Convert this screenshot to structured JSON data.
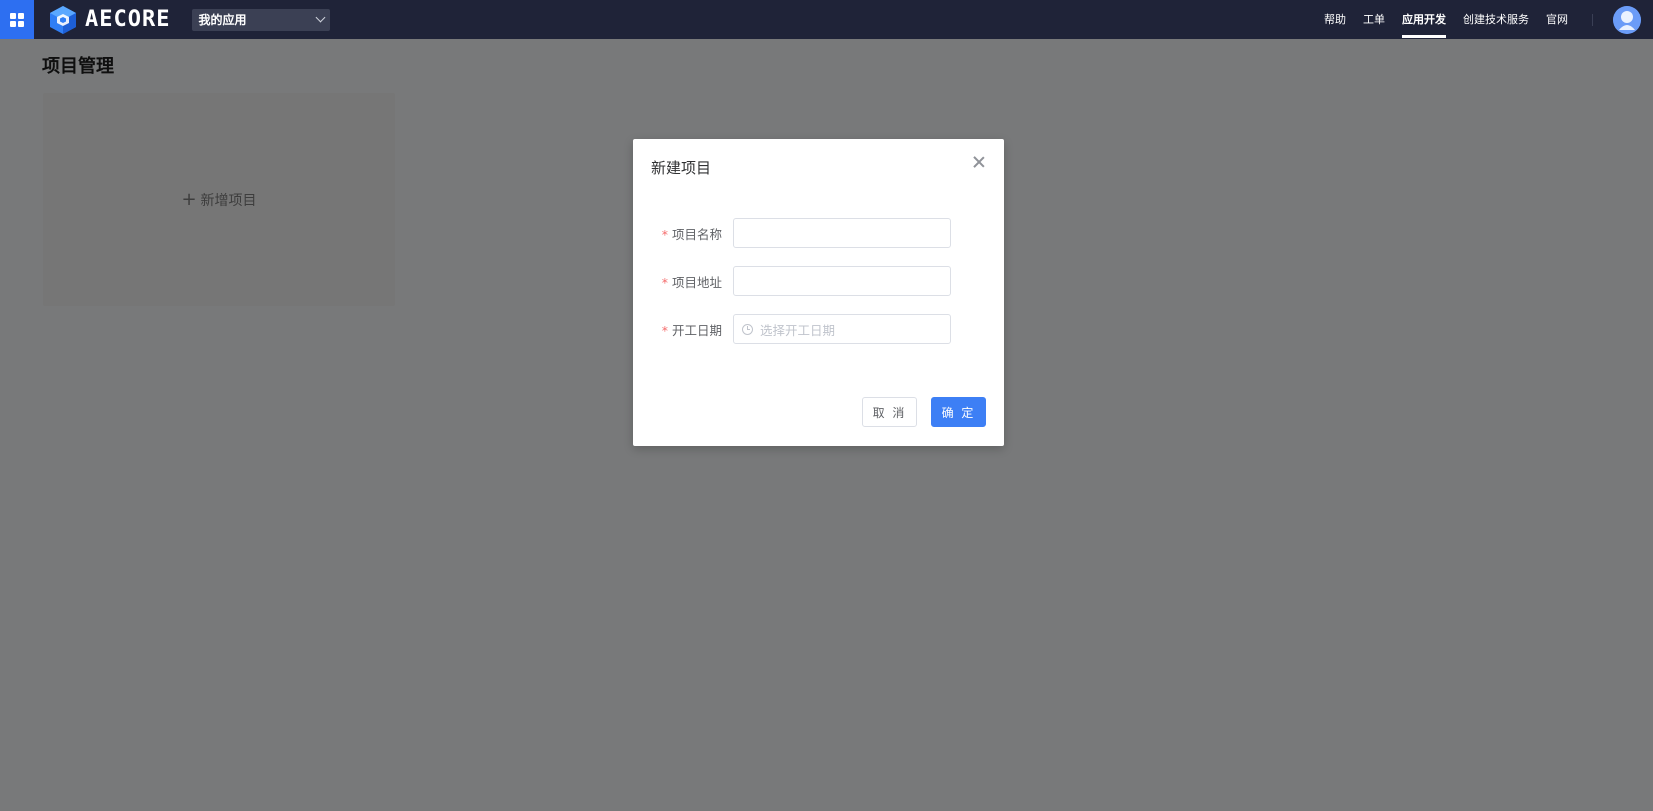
{
  "topbar": {
    "logo_text": "AECORE",
    "app_select_value": "我的应用",
    "nav": [
      {
        "label": "帮助",
        "active": false
      },
      {
        "label": "工单",
        "active": false
      },
      {
        "label": "应用开发",
        "active": true
      },
      {
        "label": "创建技术服务",
        "active": false
      },
      {
        "label": "官网",
        "active": false
      }
    ]
  },
  "page": {
    "title": "项目管理",
    "add_card_label": "新增项目"
  },
  "modal": {
    "title": "新建项目",
    "fields": [
      {
        "label": "项目名称",
        "required": true,
        "value": "",
        "placeholder": ""
      },
      {
        "label": "项目地址",
        "required": true,
        "value": "",
        "placeholder": ""
      },
      {
        "label": "开工日期",
        "required": true,
        "value": "",
        "placeholder": "选择开工日期"
      }
    ],
    "cancel_label": "取 消",
    "ok_label": "确 定"
  },
  "colors": {
    "topbar_bg": "#1f2338",
    "accent": "#3d7ff5",
    "required": "#f56c6c"
  }
}
